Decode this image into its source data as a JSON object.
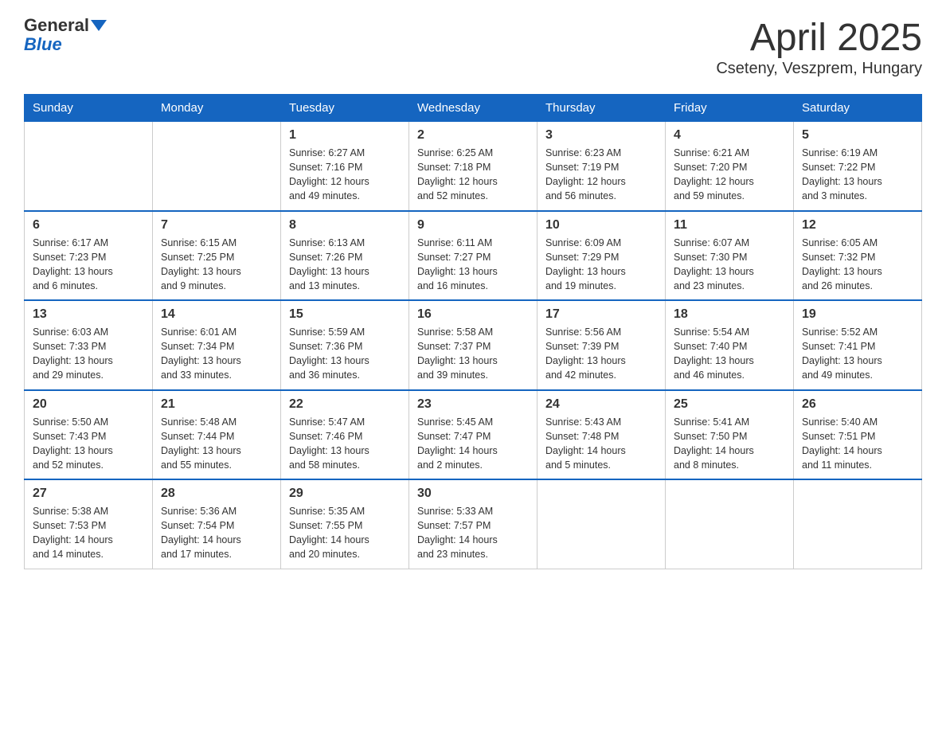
{
  "header": {
    "logo_line1": "General",
    "logo_line2": "Blue",
    "title": "April 2025",
    "subtitle": "Cseteny, Veszprem, Hungary"
  },
  "days_of_week": [
    "Sunday",
    "Monday",
    "Tuesday",
    "Wednesday",
    "Thursday",
    "Friday",
    "Saturday"
  ],
  "weeks": [
    [
      {
        "day": "",
        "info": ""
      },
      {
        "day": "",
        "info": ""
      },
      {
        "day": "1",
        "info": "Sunrise: 6:27 AM\nSunset: 7:16 PM\nDaylight: 12 hours\nand 49 minutes."
      },
      {
        "day": "2",
        "info": "Sunrise: 6:25 AM\nSunset: 7:18 PM\nDaylight: 12 hours\nand 52 minutes."
      },
      {
        "day": "3",
        "info": "Sunrise: 6:23 AM\nSunset: 7:19 PM\nDaylight: 12 hours\nand 56 minutes."
      },
      {
        "day": "4",
        "info": "Sunrise: 6:21 AM\nSunset: 7:20 PM\nDaylight: 12 hours\nand 59 minutes."
      },
      {
        "day": "5",
        "info": "Sunrise: 6:19 AM\nSunset: 7:22 PM\nDaylight: 13 hours\nand 3 minutes."
      }
    ],
    [
      {
        "day": "6",
        "info": "Sunrise: 6:17 AM\nSunset: 7:23 PM\nDaylight: 13 hours\nand 6 minutes."
      },
      {
        "day": "7",
        "info": "Sunrise: 6:15 AM\nSunset: 7:25 PM\nDaylight: 13 hours\nand 9 minutes."
      },
      {
        "day": "8",
        "info": "Sunrise: 6:13 AM\nSunset: 7:26 PM\nDaylight: 13 hours\nand 13 minutes."
      },
      {
        "day": "9",
        "info": "Sunrise: 6:11 AM\nSunset: 7:27 PM\nDaylight: 13 hours\nand 16 minutes."
      },
      {
        "day": "10",
        "info": "Sunrise: 6:09 AM\nSunset: 7:29 PM\nDaylight: 13 hours\nand 19 minutes."
      },
      {
        "day": "11",
        "info": "Sunrise: 6:07 AM\nSunset: 7:30 PM\nDaylight: 13 hours\nand 23 minutes."
      },
      {
        "day": "12",
        "info": "Sunrise: 6:05 AM\nSunset: 7:32 PM\nDaylight: 13 hours\nand 26 minutes."
      }
    ],
    [
      {
        "day": "13",
        "info": "Sunrise: 6:03 AM\nSunset: 7:33 PM\nDaylight: 13 hours\nand 29 minutes."
      },
      {
        "day": "14",
        "info": "Sunrise: 6:01 AM\nSunset: 7:34 PM\nDaylight: 13 hours\nand 33 minutes."
      },
      {
        "day": "15",
        "info": "Sunrise: 5:59 AM\nSunset: 7:36 PM\nDaylight: 13 hours\nand 36 minutes."
      },
      {
        "day": "16",
        "info": "Sunrise: 5:58 AM\nSunset: 7:37 PM\nDaylight: 13 hours\nand 39 minutes."
      },
      {
        "day": "17",
        "info": "Sunrise: 5:56 AM\nSunset: 7:39 PM\nDaylight: 13 hours\nand 42 minutes."
      },
      {
        "day": "18",
        "info": "Sunrise: 5:54 AM\nSunset: 7:40 PM\nDaylight: 13 hours\nand 46 minutes."
      },
      {
        "day": "19",
        "info": "Sunrise: 5:52 AM\nSunset: 7:41 PM\nDaylight: 13 hours\nand 49 minutes."
      }
    ],
    [
      {
        "day": "20",
        "info": "Sunrise: 5:50 AM\nSunset: 7:43 PM\nDaylight: 13 hours\nand 52 minutes."
      },
      {
        "day": "21",
        "info": "Sunrise: 5:48 AM\nSunset: 7:44 PM\nDaylight: 13 hours\nand 55 minutes."
      },
      {
        "day": "22",
        "info": "Sunrise: 5:47 AM\nSunset: 7:46 PM\nDaylight: 13 hours\nand 58 minutes."
      },
      {
        "day": "23",
        "info": "Sunrise: 5:45 AM\nSunset: 7:47 PM\nDaylight: 14 hours\nand 2 minutes."
      },
      {
        "day": "24",
        "info": "Sunrise: 5:43 AM\nSunset: 7:48 PM\nDaylight: 14 hours\nand 5 minutes."
      },
      {
        "day": "25",
        "info": "Sunrise: 5:41 AM\nSunset: 7:50 PM\nDaylight: 14 hours\nand 8 minutes."
      },
      {
        "day": "26",
        "info": "Sunrise: 5:40 AM\nSunset: 7:51 PM\nDaylight: 14 hours\nand 11 minutes."
      }
    ],
    [
      {
        "day": "27",
        "info": "Sunrise: 5:38 AM\nSunset: 7:53 PM\nDaylight: 14 hours\nand 14 minutes."
      },
      {
        "day": "28",
        "info": "Sunrise: 5:36 AM\nSunset: 7:54 PM\nDaylight: 14 hours\nand 17 minutes."
      },
      {
        "day": "29",
        "info": "Sunrise: 5:35 AM\nSunset: 7:55 PM\nDaylight: 14 hours\nand 20 minutes."
      },
      {
        "day": "30",
        "info": "Sunrise: 5:33 AM\nSunset: 7:57 PM\nDaylight: 14 hours\nand 23 minutes."
      },
      {
        "day": "",
        "info": ""
      },
      {
        "day": "",
        "info": ""
      },
      {
        "day": "",
        "info": ""
      }
    ]
  ]
}
